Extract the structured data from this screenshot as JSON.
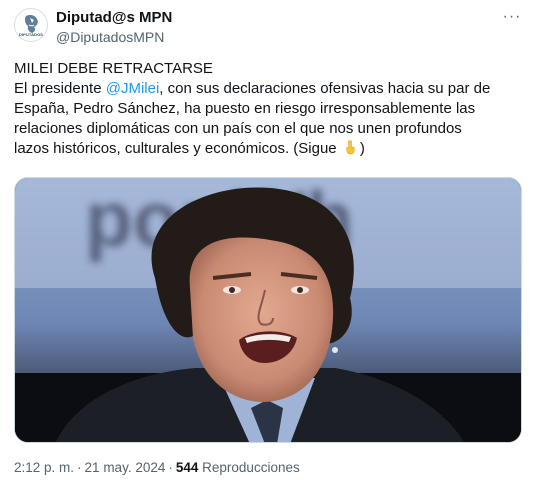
{
  "author": {
    "display_name": "Diputad@s MPN",
    "handle": "@DiputadosMPN",
    "avatar_text": "DIPUTADOS",
    "avatar_icon": "mpn-logo-icon"
  },
  "menu": {
    "more_label": "···",
    "icon": "more-horizontal-icon"
  },
  "tweet": {
    "line1": "MILEI DEBE RETRACTARSE",
    "line2_prefix": "El presidente ",
    "mention": "@JMilei",
    "line2_suffix": ", con sus declaraciones ofensivas hacia su par de",
    "line3": "España, Pedro Sánchez, ha puesto en riesgo irresponsablemente las",
    "line4": "relaciones diplomáticas con un país con el que nos unen profundos",
    "line5_prefix": "lazos históricos, culturales y económicos. (Sigue ",
    "line5_emoji": "pointing-down-emoji",
    "line5_suffix": ")"
  },
  "media": {
    "description_icon": "photo-of-man-speaking",
    "background_text": "por Wh"
  },
  "meta": {
    "time": "2:12 p. m.",
    "separator": "·",
    "date": "21 may. 2024",
    "views_count": "544",
    "views_label": "Reproducciones"
  },
  "colors": {
    "text": "#0f1419",
    "secondary": "#536471",
    "link": "#1d9bf0",
    "border": "#cfd9de"
  }
}
